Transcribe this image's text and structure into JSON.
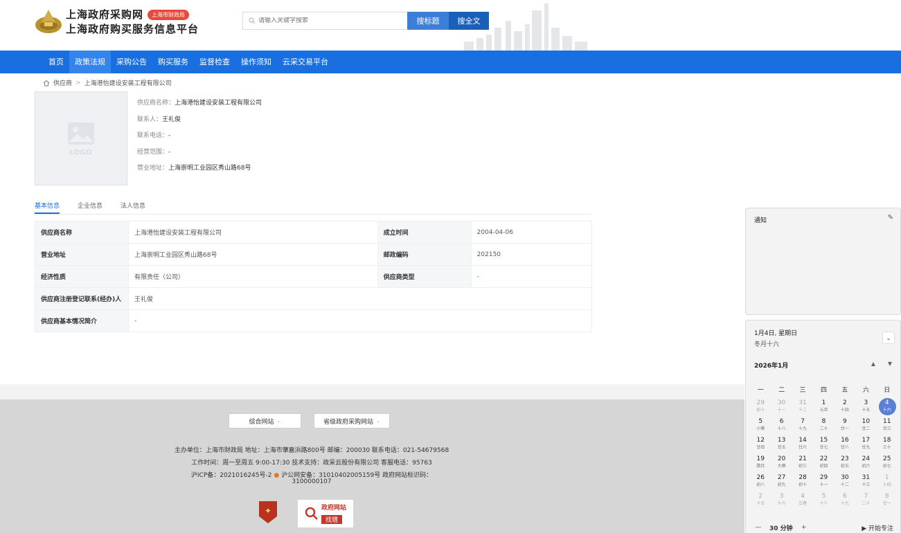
{
  "header": {
    "site_name": "上海政府采购网",
    "site_badge": "上海市财政局",
    "site_sub": "上海政府购买服务信息平台",
    "search_placeholder": "请输入关键字搜索",
    "btn_search_title": "搜标题",
    "btn_search_full": "搜全文"
  },
  "nav": {
    "items": [
      "首页",
      "政策法规",
      "采购公告",
      "购买服务",
      "监督检查",
      "操作须知",
      "云采交易平台"
    ],
    "active": "政策法规"
  },
  "breadcrumb": {
    "home_icon": "home-icon",
    "items": [
      "供应商",
      "上海港怡建设安装工程有限公司"
    ],
    "separator": ">"
  },
  "profile": {
    "logo_placeholder": "LOGO",
    "rows": [
      {
        "label": "供应商名称：",
        "value": "上海港怡建设安装工程有限公司"
      },
      {
        "label": "联系人：",
        "value": "王礼俊"
      },
      {
        "label": "联系电话：",
        "value": "-"
      },
      {
        "label": "经营范围：",
        "value": "-"
      },
      {
        "label": "营业地址：",
        "value": "上海崇明工业园区秀山路68号"
      }
    ]
  },
  "tabs": {
    "items": [
      "基本信息",
      "企业信息",
      "法人信息"
    ],
    "active": "基本信息"
  },
  "info_table": {
    "rows": [
      [
        {
          "k": "供应商名称",
          "v": "上海港怡建设安装工程有限公司"
        },
        {
          "k": "成立时间",
          "v": "2004-04-06"
        }
      ],
      [
        {
          "k": "营业地址",
          "v": "上海崇明工业园区秀山路68号"
        },
        {
          "k": "邮政编码",
          "v": "202150"
        }
      ],
      [
        {
          "k": "经济性质",
          "v": "有限责任（公司）"
        },
        {
          "k": "供应商类型",
          "v": "-"
        }
      ],
      [
        {
          "k": "供应商注册登记联系(经办)人",
          "v": "王礼俊"
        }
      ],
      [
        {
          "k": "供应商基本情况简介",
          "v": "-"
        }
      ]
    ]
  },
  "footer": {
    "select_1": "综合网站",
    "select_2": "省级政府采购网站",
    "line_1": "主办单位：上海市财政局 地址：上海市肇嘉浜路800号 邮编：200030 联系电话：021-54679568",
    "line_2": "工作时间：周一至周五 9:00-17:30 技术支持：政采云股份有限公司 客服电话：95763",
    "line_3a": "沪ICP备：2021016245号-2",
    "line_3b": "沪公网安备：31010402005159号 政府网站标识码：",
    "line_4": "3100000107",
    "find_error_1": "政府网站",
    "find_error_2": "找错"
  },
  "notification": {
    "title": "通知",
    "icon": "edit-icon"
  },
  "calendar": {
    "date_line": "1月4日, 星期日",
    "lunar_line": "冬月十六",
    "month_label": "2026年1月",
    "weekdays": [
      "一",
      "二",
      "三",
      "四",
      "五",
      "六",
      "日"
    ],
    "days": [
      {
        "n": "29",
        "l": "初十",
        "dim": true
      },
      {
        "n": "30",
        "l": "十一",
        "dim": true
      },
      {
        "n": "31",
        "l": "十二",
        "dim": true
      },
      {
        "n": "1",
        "l": "元旦"
      },
      {
        "n": "2",
        "l": "十四"
      },
      {
        "n": "3",
        "l": "十五"
      },
      {
        "n": "4",
        "l": "十六",
        "today": true
      },
      {
        "n": "5",
        "l": "小寒"
      },
      {
        "n": "6",
        "l": "十八"
      },
      {
        "n": "7",
        "l": "十九"
      },
      {
        "n": "8",
        "l": "二十"
      },
      {
        "n": "9",
        "l": "廿一"
      },
      {
        "n": "10",
        "l": "廿二"
      },
      {
        "n": "11",
        "l": "廿三"
      },
      {
        "n": "12",
        "l": "廿四"
      },
      {
        "n": "13",
        "l": "廿五"
      },
      {
        "n": "14",
        "l": "廿六"
      },
      {
        "n": "15",
        "l": "廿七"
      },
      {
        "n": "16",
        "l": "廿八"
      },
      {
        "n": "17",
        "l": "廿九"
      },
      {
        "n": "18",
        "l": "三十"
      },
      {
        "n": "19",
        "l": "腊月"
      },
      {
        "n": "20",
        "l": "大寒"
      },
      {
        "n": "21",
        "l": "初三"
      },
      {
        "n": "22",
        "l": "初四"
      },
      {
        "n": "23",
        "l": "初五"
      },
      {
        "n": "24",
        "l": "初六"
      },
      {
        "n": "25",
        "l": "初七"
      },
      {
        "n": "26",
        "l": "初八"
      },
      {
        "n": "27",
        "l": "初九"
      },
      {
        "n": "28",
        "l": "初十"
      },
      {
        "n": "29",
        "l": "十一"
      },
      {
        "n": "30",
        "l": "十二"
      },
      {
        "n": "31",
        "l": "十三"
      },
      {
        "n": "1",
        "l": "十四",
        "dim": true
      },
      {
        "n": "2",
        "l": "十五",
        "dim": true
      },
      {
        "n": "3",
        "l": "十六",
        "dim": true
      },
      {
        "n": "4",
        "l": "立春",
        "dim": true
      },
      {
        "n": "5",
        "l": "十八",
        "dim": true
      },
      {
        "n": "6",
        "l": "十九",
        "dim": true
      },
      {
        "n": "7",
        "l": "二十",
        "dim": true
      },
      {
        "n": "8",
        "l": "廿一",
        "dim": true
      }
    ],
    "minus": "—",
    "duration": "30 分钟",
    "plus": "+",
    "focus": "▶ 开始专注"
  },
  "colors": {
    "nav_blue": "#1a6fe0",
    "search_btn": "#3d7fd6",
    "search_btn_dark": "#1a5fb8",
    "badge_red": "#e8493c",
    "today_blue": "#5b7fd3"
  }
}
